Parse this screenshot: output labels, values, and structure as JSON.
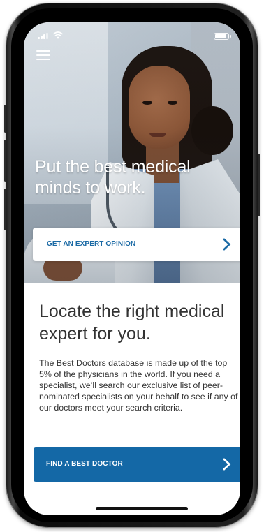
{
  "status_bar": {
    "signal_icon": "cellular-signal-icon",
    "wifi_icon": "wifi-icon",
    "battery_icon": "battery-icon"
  },
  "nav": {
    "menu_icon": "hamburger-menu-icon"
  },
  "hero": {
    "headline": "Put the best medical minds to work.",
    "image": "doctor-photo"
  },
  "expert_card": {
    "label": "GET AN EXPERT OPINION",
    "icon": "chevron-right-icon"
  },
  "section": {
    "title": "Locate the right medical expert for you.",
    "body": "The Best Doctors database is made up of the top 5% of the physicians in the world. If you need a specialist, we’ll search our exclusive list of peer-nominated specialists on your behalf to see if any of our doctors meet your search criteria."
  },
  "find_button": {
    "label": "FIND A BEST DOCTOR",
    "icon": "chevron-right-icon"
  },
  "colors": {
    "brand_blue": "#1468a6",
    "link_blue": "#1b6aa5",
    "text_dark": "#333333"
  }
}
